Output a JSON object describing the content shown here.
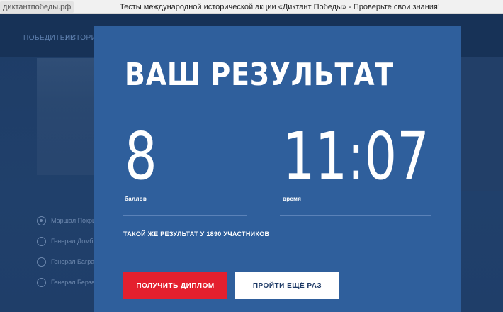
{
  "browser": {
    "url": "диктантпобеды.рф",
    "title": "Тесты международной исторической акции «Диктант Победы» - Проверьте свои знания!"
  },
  "background": {
    "nav_links": [
      "ПОБЕДИТЕЛИ",
      "ИСТОРИЧЕС"
    ],
    "options": [
      {
        "text": "Маршал Покрышкин",
        "checked": true
      },
      {
        "text": "Генерал Домбровский",
        "checked": false
      },
      {
        "text": "Генерал Баграмян",
        "checked": false
      },
      {
        "text": "Генерал Берзарин",
        "checked": false
      }
    ]
  },
  "modal": {
    "title": "ВАШ РЕЗУЛЬТАТ",
    "score": {
      "value": "8",
      "label": "баллов"
    },
    "time": {
      "value": "11:07",
      "label": "время"
    },
    "same_result_text": "ТАКОЙ ЖЕ РЕЗУЛЬТАТ У 1890 УЧАСТНИКОВ",
    "buttons": {
      "diploma": "ПОЛУЧИТЬ ДИПЛОМ",
      "retry": "ПРОЙТИ ЕЩЁ РАЗ"
    }
  },
  "colors": {
    "modal_bg": "#2f5f9c",
    "page_bg": "#1c3f6e",
    "primary_button": "#e4202e",
    "secondary_button": "#ffffff"
  }
}
